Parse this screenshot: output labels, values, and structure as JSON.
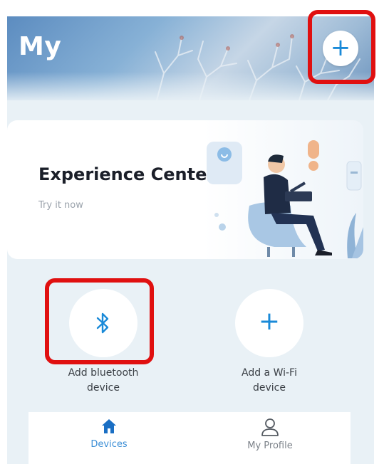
{
  "header": {
    "title": "My",
    "add_icon": "plus-icon",
    "add_symbol": "+"
  },
  "banner": {
    "title": "Experience Center",
    "subtitle": "Try it now"
  },
  "actions": [
    {
      "label_line1": "Add bluetooth",
      "label_line2": "device",
      "icon": "bluetooth-icon"
    },
    {
      "label_line1": "Add a Wi-Fi",
      "label_line2": "device",
      "icon": "plus-icon",
      "symbol": "+"
    }
  ],
  "nav": {
    "items": [
      {
        "label": "Devices",
        "icon": "home-icon",
        "active": true
      },
      {
        "label": "My Profile",
        "icon": "person-icon",
        "active": false
      }
    ]
  },
  "colors": {
    "accent": "#1a8ad8",
    "highlight": "#e01010",
    "background": "#e9f1f6",
    "active_nav": "#3d8fd6"
  }
}
